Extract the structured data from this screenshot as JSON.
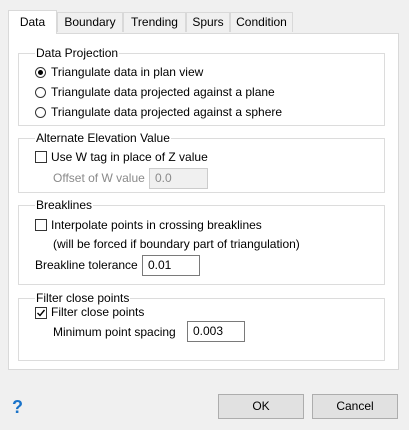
{
  "tabs": [
    "Data",
    "Boundary",
    "Trending",
    "Spurs",
    "Condition"
  ],
  "data_projection": {
    "title": "Data Projection",
    "options": [
      "Triangulate data in plan view",
      "Triangulate data projected against a plane",
      "Triangulate data projected against a sphere"
    ],
    "selected_index": 0
  },
  "alternate_elevation": {
    "title": "Alternate Elevation Value",
    "use_w_tag_label": "Use W tag in place of Z value",
    "use_w_tag_checked": false,
    "offset_label": "Offset of W value",
    "offset_value": "0.0"
  },
  "breaklines": {
    "title": "Breaklines",
    "interpolate_label": "Interpolate points in crossing breaklines",
    "interpolate_checked": false,
    "note": "(will be forced if boundary part of triangulation)",
    "tolerance_label": "Breakline tolerance",
    "tolerance_value": "0.01"
  },
  "filter": {
    "title": "Filter close points",
    "checkbox_label": "Filter close points",
    "checked": true,
    "spacing_label": "Minimum point spacing",
    "spacing_value": "0.003"
  },
  "buttons": {
    "ok": "OK",
    "cancel": "Cancel",
    "help": "?"
  }
}
